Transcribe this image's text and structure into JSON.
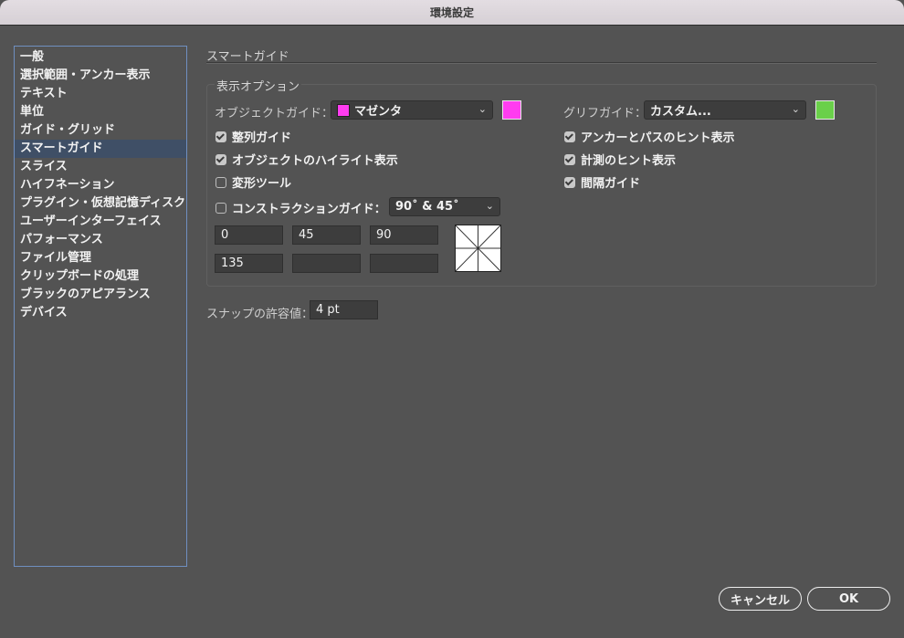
{
  "window": {
    "title": "環境設定"
  },
  "sidebar": {
    "items": [
      {
        "label": "一般"
      },
      {
        "label": "選択範囲・アンカー表示"
      },
      {
        "label": "テキスト"
      },
      {
        "label": "単位"
      },
      {
        "label": "ガイド・グリッド"
      },
      {
        "label": "スマートガイド",
        "selected": true
      },
      {
        "label": "スライス"
      },
      {
        "label": "ハイフネーション"
      },
      {
        "label": "プラグイン・仮想記憶ディスク"
      },
      {
        "label": "ユーザーインターフェイス"
      },
      {
        "label": "パフォーマンス"
      },
      {
        "label": "ファイル管理"
      },
      {
        "label": "クリップボードの処理"
      },
      {
        "label": "ブラックのアピアランス"
      },
      {
        "label": "デバイス"
      }
    ]
  },
  "main": {
    "section_title": "スマートガイド",
    "display_options": {
      "group_label": "表示オプション",
      "object_guide": {
        "label": "オブジェクトガイド：",
        "value": "マゼンタ",
        "color": "#ff3cf0"
      },
      "glyph_guide": {
        "label": "グリフガイド：",
        "value": "カスタム...",
        "color": "#6ad04a"
      },
      "checkboxes_left": [
        {
          "label": "整列ガイド",
          "checked": true
        },
        {
          "label": "オブジェクトのハイライト表示",
          "checked": true
        },
        {
          "label": "変形ツール",
          "checked": false
        }
      ],
      "checkboxes_right": [
        {
          "label": "アンカーとパスのヒント表示",
          "checked": true
        },
        {
          "label": "計測のヒント表示",
          "checked": true
        },
        {
          "label": "間隔ガイド",
          "checked": true
        }
      ],
      "construction": {
        "label": "コンストラクションガイド：",
        "checked": false,
        "value": "90˚ & 45˚",
        "angles": [
          "0",
          "45",
          "90",
          "135",
          "",
          ""
        ]
      }
    },
    "snap_tolerance": {
      "label": "スナップの許容値：",
      "value": "4 pt"
    }
  },
  "buttons": {
    "cancel": "キャンセル",
    "ok": "OK"
  }
}
